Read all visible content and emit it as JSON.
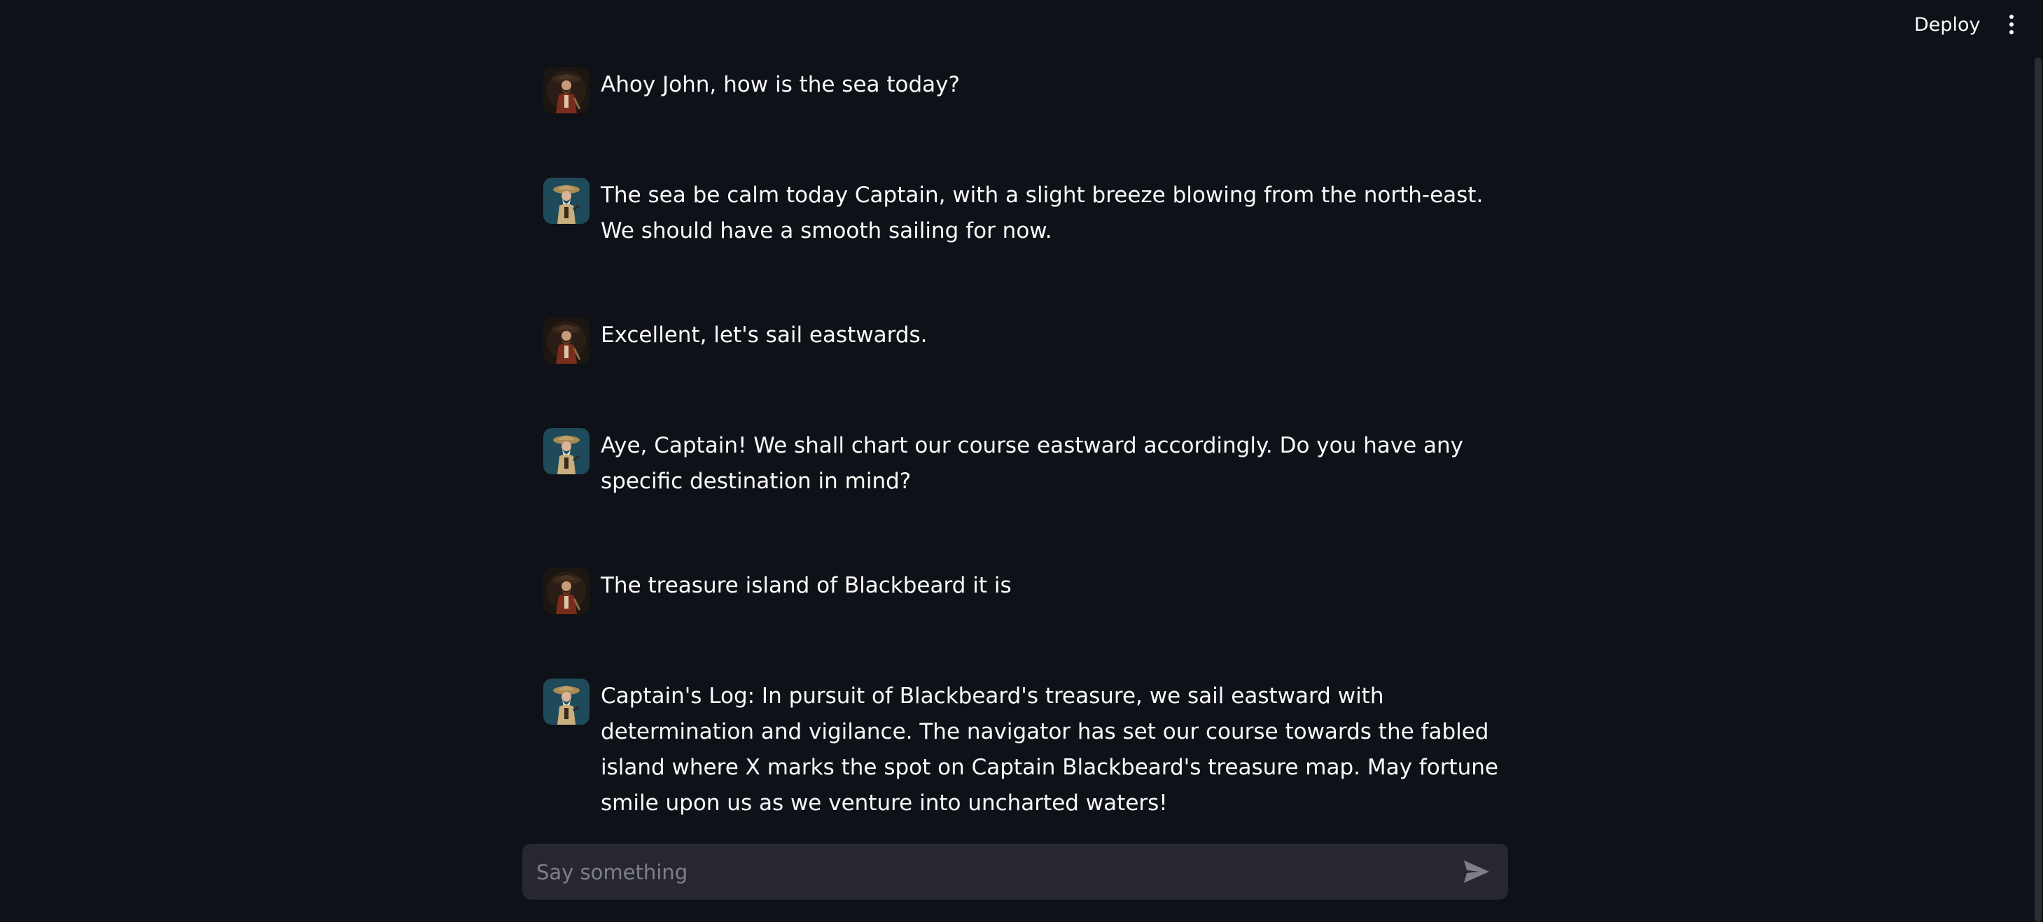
{
  "header": {
    "deploy_label": "Deploy",
    "menu_icon": "more-vertical-icon"
  },
  "messages": [
    {
      "role": "user",
      "avatar": "captain-avatar",
      "text": "Ahoy John, how is the sea today?"
    },
    {
      "role": "assistant",
      "avatar": "navigator-avatar",
      "text": "The sea be calm today Captain, with a slight breeze blowing from the north-east. We should have a smooth sailing for now."
    },
    {
      "role": "user",
      "avatar": "captain-avatar",
      "text": "Excellent, let's sail eastwards."
    },
    {
      "role": "assistant",
      "avatar": "navigator-avatar",
      "text": "Aye, Captain! We shall chart our course eastward accordingly. Do you have any specific destination in mind?"
    },
    {
      "role": "user",
      "avatar": "captain-avatar",
      "text": "The treasure island of Blackbeard it is"
    },
    {
      "role": "assistant",
      "avatar": "navigator-avatar",
      "text": "Captain's Log: In pursuit of Blackbeard's treasure, we sail eastward with determination and vigilance. The navigator has set our course towards the fabled island where X marks the spot on Captain Blackbeard's treasure map. May fortune smile upon us as we venture into uncharted waters!"
    }
  ],
  "chat_input": {
    "placeholder": "Say something",
    "value": "",
    "send_icon": "send-icon"
  },
  "colors": {
    "background": "#0e1117",
    "input_background": "#262730",
    "text": "#fafafa",
    "placeholder": "#7f8087"
  }
}
